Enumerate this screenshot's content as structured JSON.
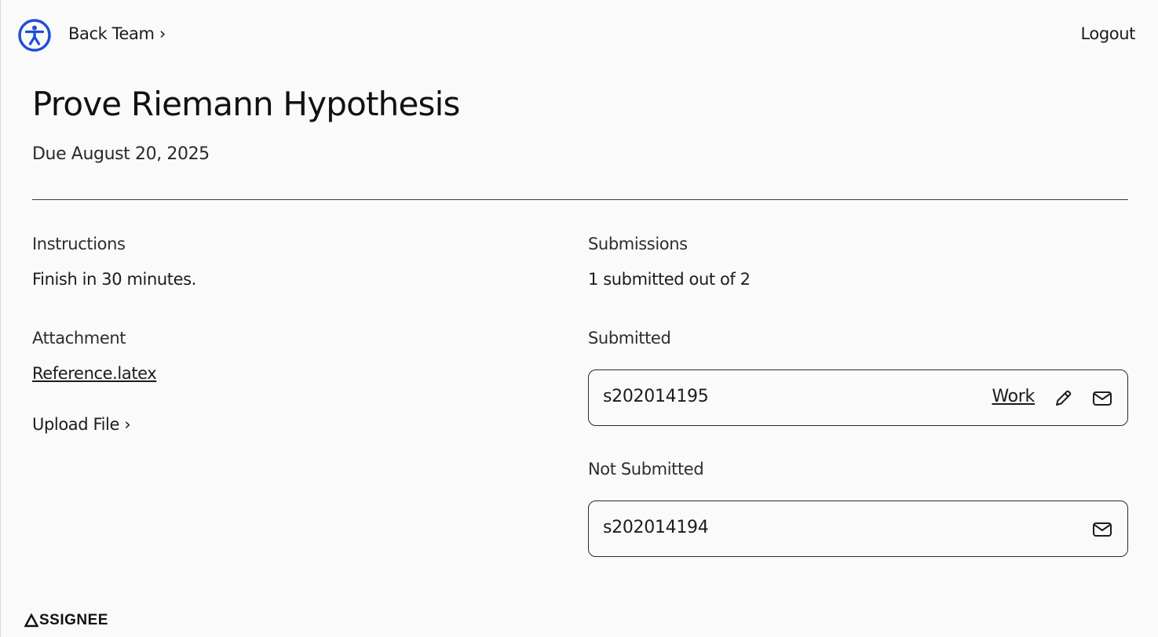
{
  "header": {
    "back_label": "Back Team ›",
    "logout_label": "Logout"
  },
  "assignment": {
    "title": "Prove Riemann Hypothesis",
    "due": "Due August 20, 2025"
  },
  "left": {
    "instructions_label": "Instructions",
    "instructions_text": "Finish in 30 minutes.",
    "attachment_label": "Attachment",
    "attachment_file": "Reference.latex",
    "upload_label": "Upload File ›"
  },
  "right": {
    "submissions_label": "Submissions",
    "submissions_summary": "1 submitted out of 2",
    "submitted_label": "Submitted",
    "submitted": [
      {
        "id": "s202014195",
        "work_label": "Work"
      }
    ],
    "not_submitted_label": "Not Submitted",
    "not_submitted": [
      {
        "id": "s202014194"
      }
    ]
  },
  "footer": {
    "brand": "SSIGNEE"
  },
  "colors": {
    "accent": "#1f4fd8",
    "background": "#fafafa",
    "text": "#1c1c1c",
    "border": "#2a2a2a"
  },
  "icons": {
    "accessibility": "accessibility-icon",
    "edit": "pencil-icon",
    "mail": "mail-icon",
    "logo": "triangle-logo-icon"
  }
}
